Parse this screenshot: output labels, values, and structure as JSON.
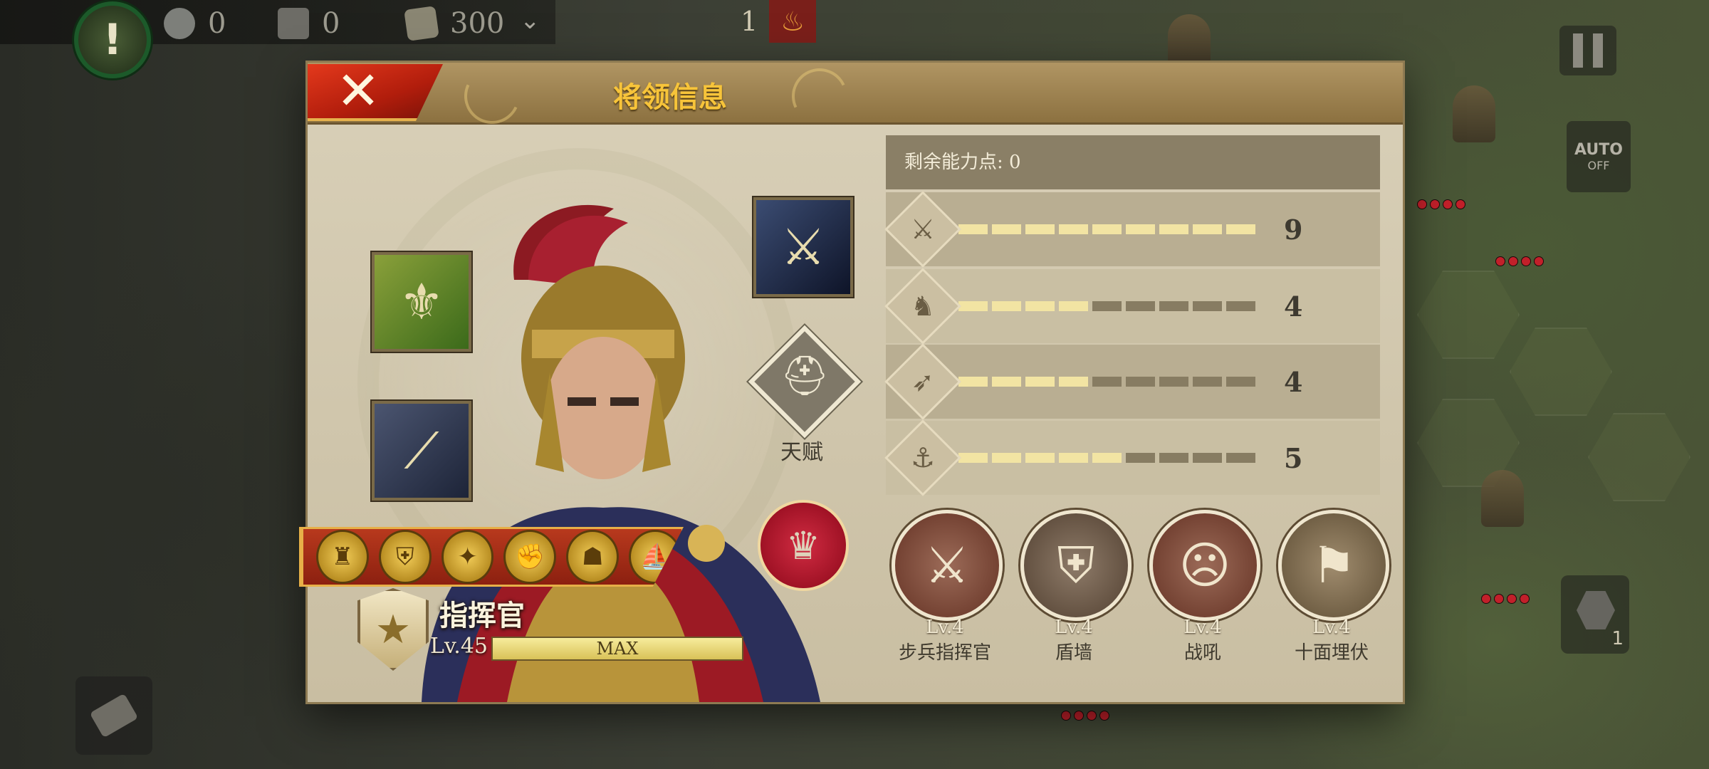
{
  "hud": {
    "alert_icon": "!",
    "resources": [
      {
        "icon": "silver-coin-icon",
        "value": "0"
      },
      {
        "icon": "hammer-icon",
        "value": "0"
      },
      {
        "icon": "scroll-icon",
        "value": "300"
      }
    ],
    "turn_label": "1"
  },
  "dialog": {
    "title": "将领信息",
    "remaining_points_label": "剩余能力点: 0",
    "talent_label": "天赋",
    "rank_name": "指挥官",
    "level_label": "Lv.45",
    "level_bar_text": "MAX",
    "level_progress": 1.0,
    "stats": [
      {
        "icon": "sword-icon",
        "value": "9",
        "filled": 9
      },
      {
        "icon": "horse-icon",
        "value": "4",
        "filled": 4
      },
      {
        "icon": "bow-icon",
        "value": "4",
        "filled": 4
      },
      {
        "icon": "anchor-icon",
        "value": "5",
        "filled": 5
      }
    ],
    "stat_max_segments": 9,
    "skills": [
      {
        "level": "Lv.4",
        "name": "步兵指挥官"
      },
      {
        "level": "Lv.4",
        "name": "盾墙"
      },
      {
        "level": "Lv.4",
        "name": "战吼"
      },
      {
        "level": "Lv.4",
        "name": "十面埋伏"
      }
    ]
  },
  "colors": {
    "accent_gold": "#f7c43a",
    "close_red": "#c1230f",
    "stat_fill": "#f2e4a3"
  }
}
